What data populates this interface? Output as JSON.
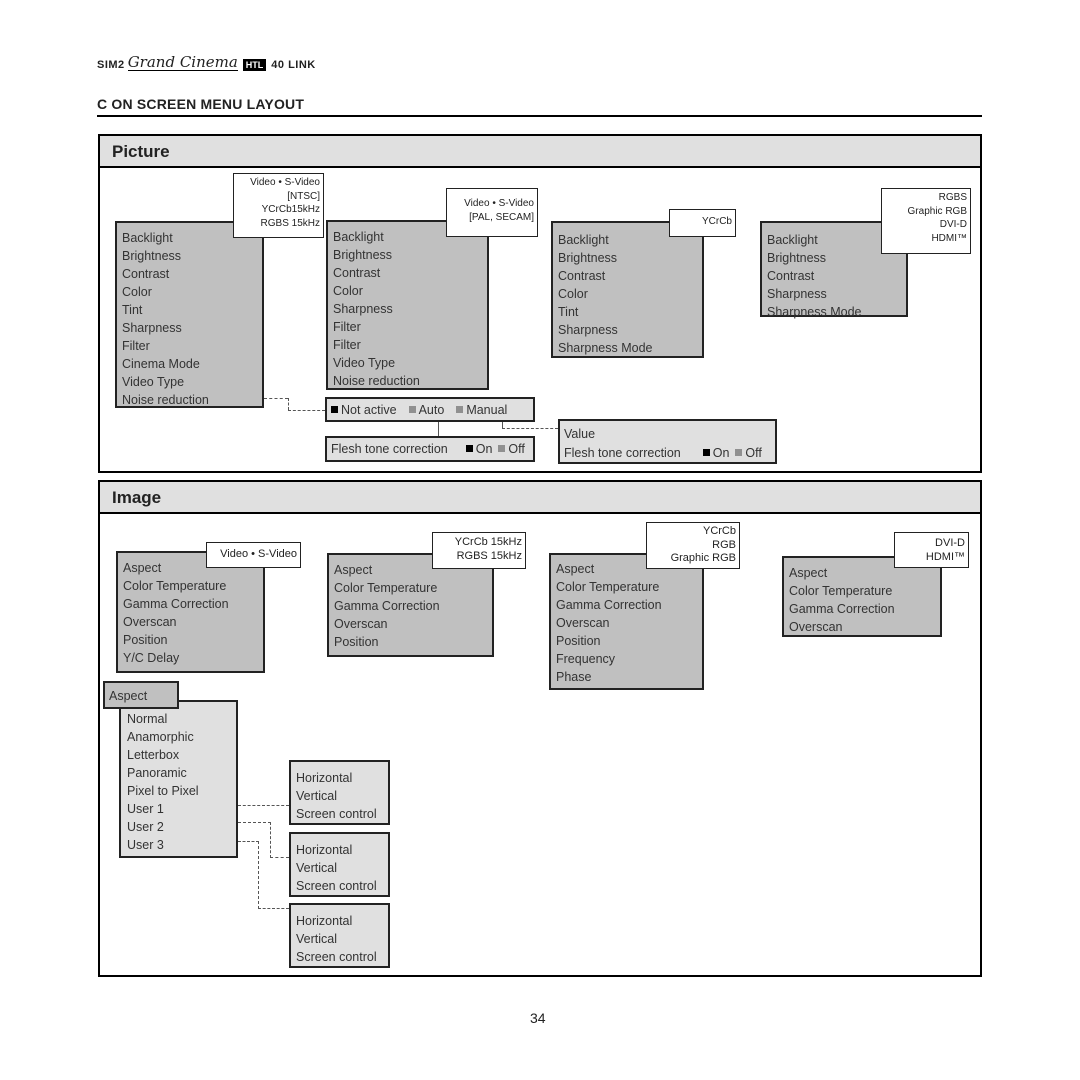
{
  "logo": {
    "brand": "SIM2",
    "product": "Grand Cinema",
    "badge": "HTL",
    "model": "40 LINK"
  },
  "heading": "C  ON SCREEN MENU LAYOUT",
  "page_number": "34",
  "colors": {
    "menu_bg": "#c0c0c0",
    "submenu_bg": "#e0e0e0",
    "selected_square": "#000000",
    "unselected_square": "#909090"
  },
  "picture": {
    "title": "Picture",
    "menus": [
      {
        "source": [
          "Video • S-Video",
          "[NTSC]",
          "YCrCb15kHz",
          "RGBS 15kHz"
        ],
        "items": [
          "Backlight",
          "Brightness",
          "Contrast",
          "Color",
          "Tint",
          "Sharpness",
          "Filter",
          "Cinema Mode",
          "Video Type",
          "Noise reduction"
        ]
      },
      {
        "source": [
          "Video • S-Video",
          "[PAL, SECAM]"
        ],
        "items": [
          "Backlight",
          "Brightness",
          "Contrast",
          "Color",
          "Sharpness",
          "Filter",
          "Filter",
          "Video Type",
          "Noise reduction"
        ]
      },
      {
        "source": [
          "YCrCb"
        ],
        "items": [
          "Backlight",
          "Brightness",
          "Contrast",
          "Color",
          "Tint",
          "Sharpness",
          "Sharpness Mode"
        ]
      },
      {
        "source": [
          "RGBS",
          "Graphic RGB",
          "DVI-D",
          "HDMI™"
        ],
        "items": [
          "Backlight",
          "Brightness",
          "Contrast",
          "Sharpness",
          "Sharpness Mode"
        ]
      }
    ],
    "noise_options": [
      {
        "label": "Not active",
        "selected": true
      },
      {
        "label": "Auto",
        "selected": false
      },
      {
        "label": "Manual",
        "selected": false
      }
    ],
    "flesh_tone": {
      "label": "Flesh tone correction",
      "options": [
        {
          "label": "On",
          "selected": true
        },
        {
          "label": "Off",
          "selected": false
        }
      ]
    },
    "manual_panel": {
      "value_label": "Value",
      "flesh_label": "Flesh tone correction",
      "options": [
        {
          "label": "On",
          "selected": true
        },
        {
          "label": "Off",
          "selected": false
        }
      ]
    }
  },
  "image": {
    "title": "Image",
    "menus": [
      {
        "source": [
          "Video • S-Video"
        ],
        "items": [
          "Aspect",
          "Color Temperature",
          "Gamma Correction",
          "Overscan",
          "Position",
          "Y/C  Delay"
        ]
      },
      {
        "source": [
          "YCrCb  15kHz",
          "RGBS  15kHz"
        ],
        "items": [
          "Aspect",
          "Color Temperature",
          "Gamma Correction",
          "Overscan",
          "Position"
        ]
      },
      {
        "source": [
          "YCrCb",
          "RGB",
          "Graphic RGB"
        ],
        "items": [
          "Aspect",
          "Color Temperature",
          "Gamma Correction",
          "Overscan",
          "Position",
          "Frequency",
          "Phase"
        ]
      },
      {
        "source": [
          "DVI-D",
          "HDMI™"
        ],
        "items": [
          "Aspect",
          "Color Temperature",
          "Gamma Correction",
          "Overscan"
        ]
      }
    ],
    "aspect": {
      "label": "Aspect",
      "items": [
        "Normal",
        "Anamorphic",
        "Letterbox",
        "Panoramic",
        "Pixel to Pixel",
        "User 1",
        "User 2",
        "User 3"
      ]
    },
    "user_submenus": [
      [
        "Horizontal",
        "Vertical",
        "Screen control"
      ],
      [
        "Horizontal",
        "Vertical",
        "Screen control"
      ],
      [
        "Horizontal",
        "Vertical",
        "Screen control"
      ]
    ]
  }
}
